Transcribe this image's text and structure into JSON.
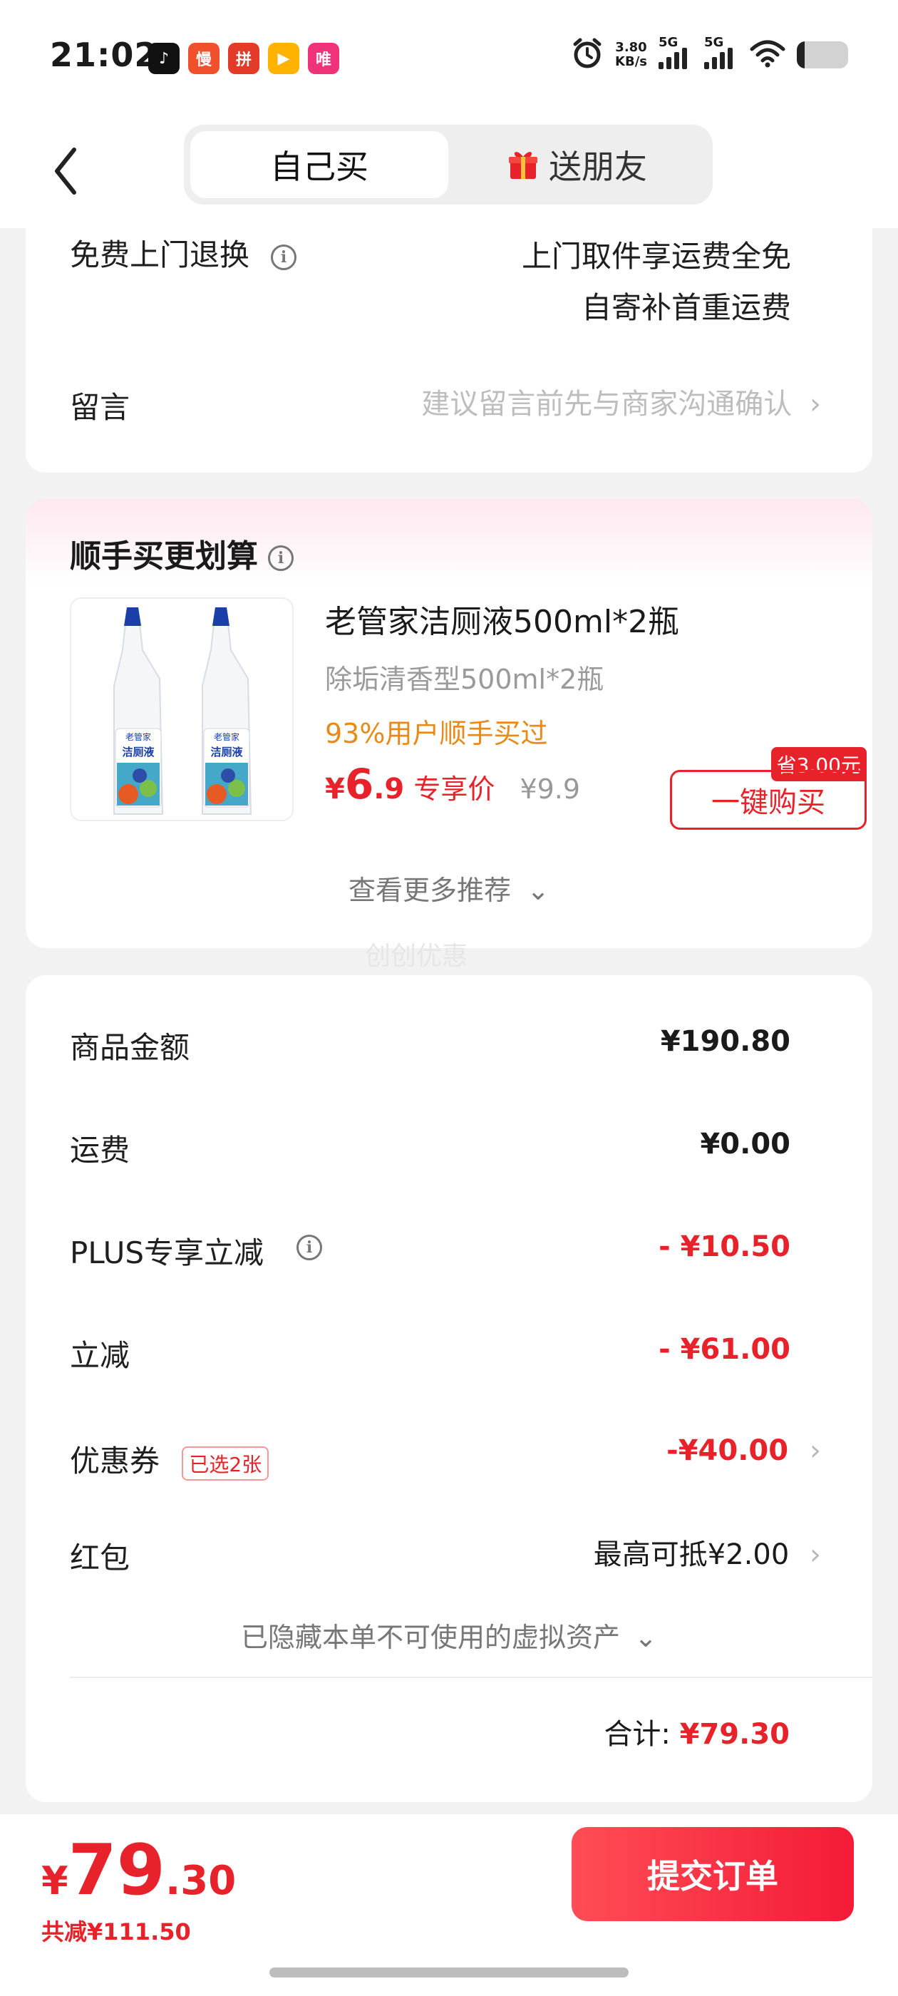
{
  "status_bar": {
    "time": "21:02",
    "apps": [
      {
        "name": "tiktok-app-icon",
        "glyph": "♪",
        "color": "#111111"
      },
      {
        "name": "manhua-app-icon",
        "glyph": "慢",
        "color": "#f1502c"
      },
      {
        "name": "pdd-app-icon",
        "glyph": "拼",
        "color": "#e33a2a"
      },
      {
        "name": "video-app-icon",
        "glyph": "▶",
        "color": "#ffb300"
      },
      {
        "name": "vip-app-icon",
        "glyph": "唯",
        "color": "#f0327a"
      }
    ],
    "speed_value": "3.80",
    "speed_unit": "KB/s",
    "signal1_label": "5G",
    "signal2_label": "5G",
    "battery_level": 0.15
  },
  "nav": {
    "tab_self": "自己买",
    "tab_gift": "送朋友"
  },
  "service": {
    "return_label": "免费上门退换",
    "return_line1": "上门取件享运费全免",
    "return_line2": "自寄补首重运费",
    "message_label": "留言",
    "message_placeholder": "建议留言前先与商家沟通确认"
  },
  "recommend": {
    "title": "顺手买更划算",
    "product_name": "老管家洁厕液500ml*2瓶",
    "product_spec": "除垢清香型500ml*2瓶",
    "buy_rate": "93%用户顺手买过",
    "price_symbol": "¥",
    "price_int": "6",
    "price_dec": ".9",
    "price_tag": "专享价",
    "original_price": "¥9.9",
    "save_badge": "省3.00元",
    "buy_button": "一键购买",
    "more_link": "查看更多推荐",
    "watermark": "创创优惠",
    "bottle_brand": "老管家",
    "bottle_label": "洁厕液"
  },
  "summary": {
    "rows": [
      {
        "label": "商品金额",
        "value": "¥190.80"
      },
      {
        "label": "运费",
        "value": "¥0.00"
      },
      {
        "label": "PLUS专享立减",
        "value": "- ¥10.50"
      },
      {
        "label": "立减",
        "value": "- ¥61.00"
      }
    ],
    "coupon_label": "优惠券",
    "coupon_badge": "已选2张",
    "coupon_value": "-¥40.00",
    "redpacket_label": "红包",
    "redpacket_value": "最高可抵¥2.00",
    "hidden_assets": "已隐藏本单不可使用的虚拟资产",
    "total_label": "合计:",
    "total_value": "¥79.30"
  },
  "footer": {
    "price_symbol": "¥",
    "price_int": "79",
    "price_dec": ".30",
    "saved": "共减¥111.50",
    "submit": "提交订单"
  },
  "colors": {
    "accent_red": "#e8222a",
    "orange": "#e88a1a",
    "submit_gradient_start": "#ff4d55",
    "submit_gradient_end": "#f41b36"
  }
}
